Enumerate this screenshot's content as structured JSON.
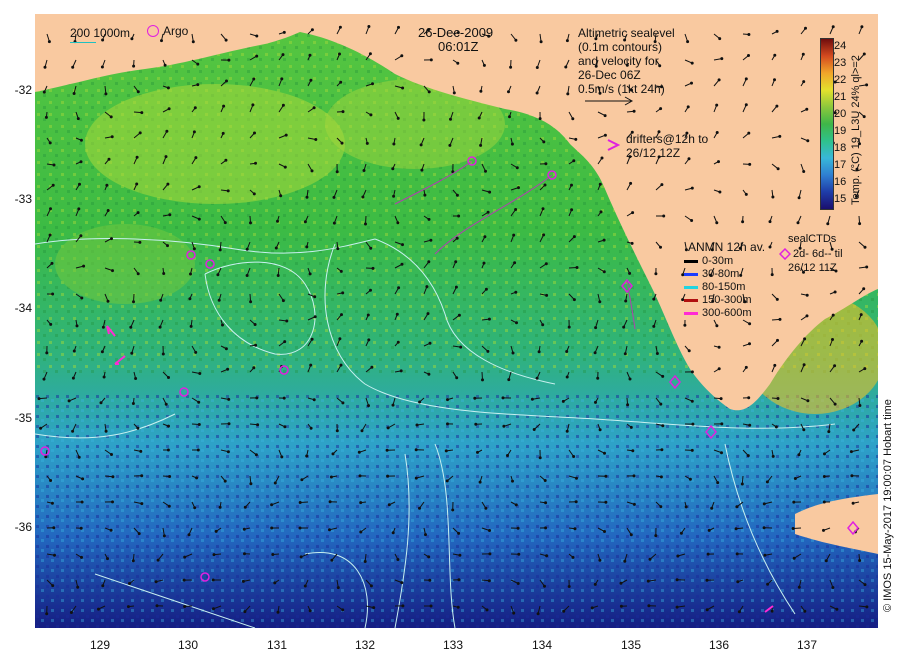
{
  "header": {
    "date": "26-Dec-2009",
    "time": "06:01Z"
  },
  "bathymetry_legend": {
    "label": "200  1000m"
  },
  "argo_legend": {
    "label": "Argo"
  },
  "altimetry_note": {
    "lines": [
      "Altimetric sealevel",
      "(0.1m contours)",
      "and velocity for",
      "26-Dec 06Z",
      "0.5m/s (1kt 24h)"
    ]
  },
  "drifters_note": {
    "lines": [
      "drifters@12h to",
      "26/12 12Z"
    ]
  },
  "anmn_legend": {
    "title": "ANMN 12h av.",
    "rows": [
      {
        "label": "0-30m",
        "color": "#000000"
      },
      {
        "label": "30-80m",
        "color": "#1a3cff"
      },
      {
        "label": "80-150m",
        "color": "#22d4e0"
      },
      {
        "label": "150-300m",
        "color": "#b01010"
      },
      {
        "label": "300-600m",
        "color": "#ff2ad4"
      }
    ]
  },
  "seal_legend": {
    "title": "sealCTDs",
    "lines": [
      "2d- 6d-- til",
      "26/12 11Z"
    ]
  },
  "colorbar": {
    "title": "Temp. (°C) 19_L3U 24% ql>=2",
    "ticks": [
      "24",
      "23",
      "22",
      "21",
      "20",
      "19",
      "18",
      "17",
      "16",
      "15"
    ]
  },
  "axes": {
    "lat_labels": [
      "-32",
      "-33",
      "-34",
      "-35",
      "-36"
    ],
    "lon_labels": [
      "129",
      "130",
      "131",
      "132",
      "133",
      "134",
      "135",
      "136",
      "137"
    ]
  },
  "credit": {
    "text": "© IMOS 15-May-2017 19:00:07 Hobart time"
  },
  "colors": {
    "land": "#f9c9a0",
    "ocean_warm": "#9ad43a",
    "ocean_mid": "#34b84a",
    "ocean_cool": "#2fb0c8",
    "ocean_cold": "#1d4fb0",
    "ocean_deep": "#141a7a",
    "argo_marker": "#e020e0",
    "contour": "#c8f0f0"
  }
}
